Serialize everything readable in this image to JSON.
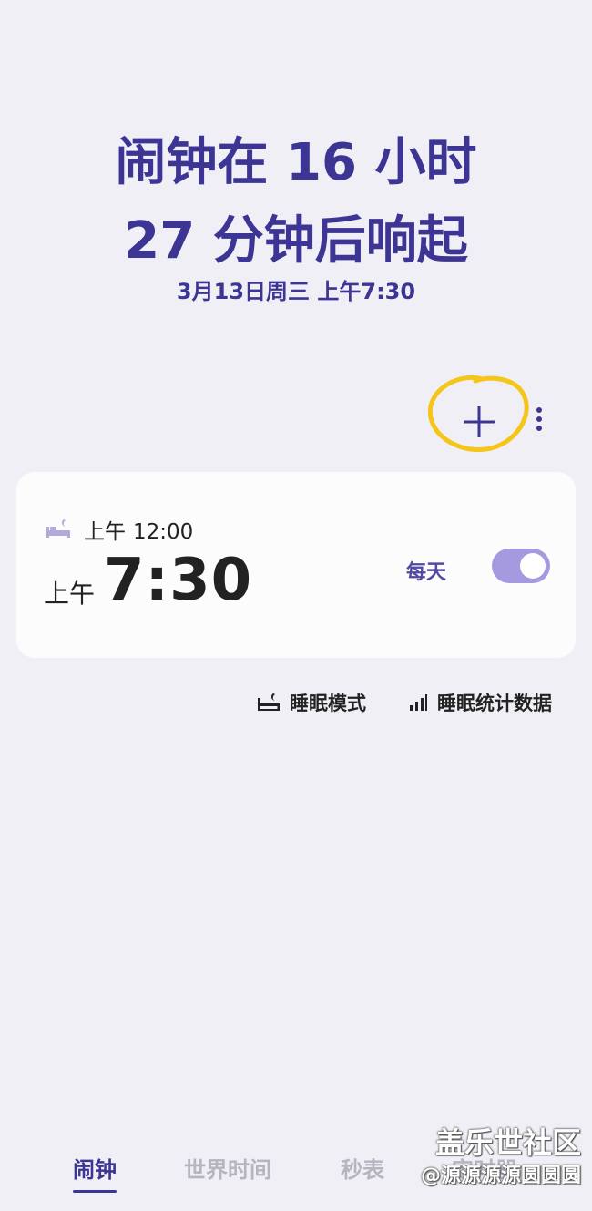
{
  "header": {
    "countdown_line1": "闹钟在 16 小时",
    "countdown_line2": "27 分钟后响起",
    "next_alarm_date": "3月13日周三 上午7:30"
  },
  "actions": {
    "add_icon": "plus-icon",
    "more_icon": "more-vertical-icon",
    "highlight_color": "#f5c518"
  },
  "alarm": {
    "bedtime_icon": "bed-icon",
    "bedtime_ampm": "上午",
    "bedtime_time": "12:00",
    "ampm": "上午",
    "time": "7:30",
    "repeat": "每天",
    "enabled": true
  },
  "links": {
    "sleep_mode": "睡眠模式",
    "sleep_stats": "睡眠统计数据"
  },
  "tabs": [
    {
      "label": "闹钟",
      "active": true
    },
    {
      "label": "世界时间",
      "active": false
    },
    {
      "label": "秒表",
      "active": false
    },
    {
      "label": "定时器",
      "active": false
    }
  ],
  "watermark": {
    "line1": "盖乐世社区",
    "line2": "@源源源源圆圆圆"
  },
  "colors": {
    "background": "#f0eff5",
    "accent": "#3c3593",
    "toggle": "#a59ae0"
  }
}
